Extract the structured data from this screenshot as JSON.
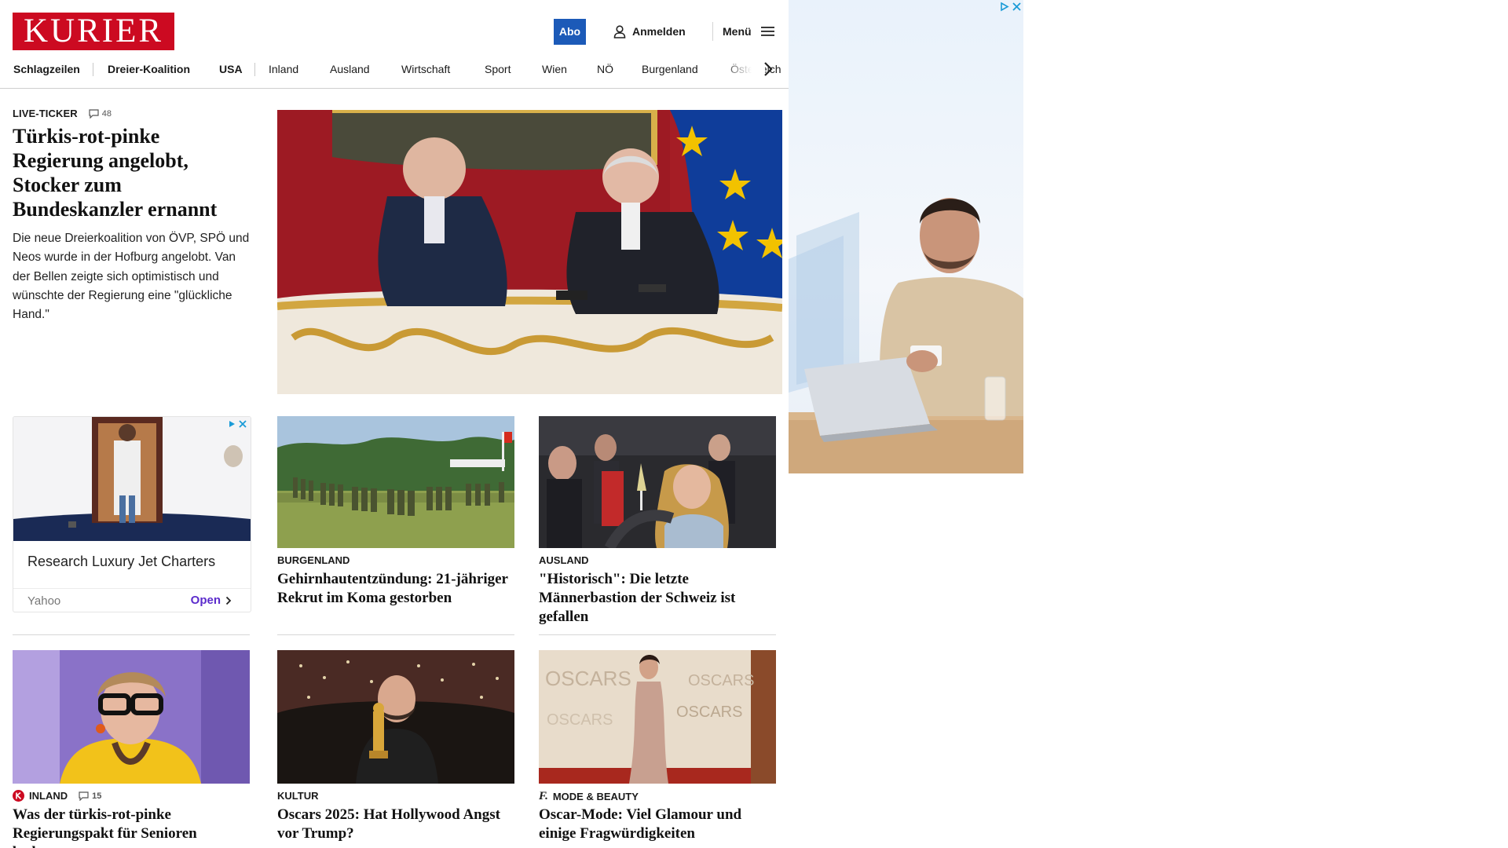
{
  "header": {
    "logo_text": "KURIER",
    "abo_label": "Abo",
    "login_label": "Anmelden",
    "menu_label": "Menü",
    "icons": [
      "user-icon",
      "hamburger-icon",
      "chevron-right-icon",
      "comment-icon"
    ]
  },
  "nav": {
    "items": [
      "Schlagzeilen",
      "Dreier-Koalition",
      "USA",
      "Inland",
      "Ausland",
      "Wirtschaft",
      "Sport",
      "Wien",
      "NÖ",
      "Burgenland",
      "Österreich"
    ]
  },
  "hero": {
    "kicker": "LIVE-TICKER",
    "comments": "48",
    "title": "Türkis-rot-pinke Regierung angelobt, Stocker zum Bundeskanzler ernannt",
    "lead": "Die neue Dreierkoalition von ÖVP, SPÖ und Neos wurde in der Hofburg angelobt. Van der Bellen zeigte sich optimistisch und wünschte der Regierung eine \"glückliche Hand.\""
  },
  "ad_tile": {
    "title": "Research Luxury Jet Charters",
    "source": "Yahoo",
    "cta": "Open"
  },
  "articles": [
    {
      "kicker": "BURGENLAND",
      "title": "Gehirnhautentzündung: 21-jähriger Rekrut im Koma gestorben"
    },
    {
      "kicker": "AUSLAND",
      "title": "\"Historisch\": Die letzte Männerbastion der Schweiz ist gefallen"
    },
    {
      "kicker": "INLAND",
      "comments": "15",
      "title": "Was der türkis-rot-pinke Regierungspakt für Senioren bedeutet"
    },
    {
      "kicker": "KULTUR",
      "title": "Oscars 2025: Hat Hollywood Angst vor Trump?"
    },
    {
      "kicker": "MODE & BEAUTY",
      "title": "Oscar-Mode: Viel Glamour und einige Fragwürdigkeiten"
    }
  ],
  "colors": {
    "brand_red": "#cc0a21",
    "abo_blue": "#1c5ab8",
    "ad_purple": "#5b2bcc",
    "adchoices_blue": "#1a9bd7"
  }
}
